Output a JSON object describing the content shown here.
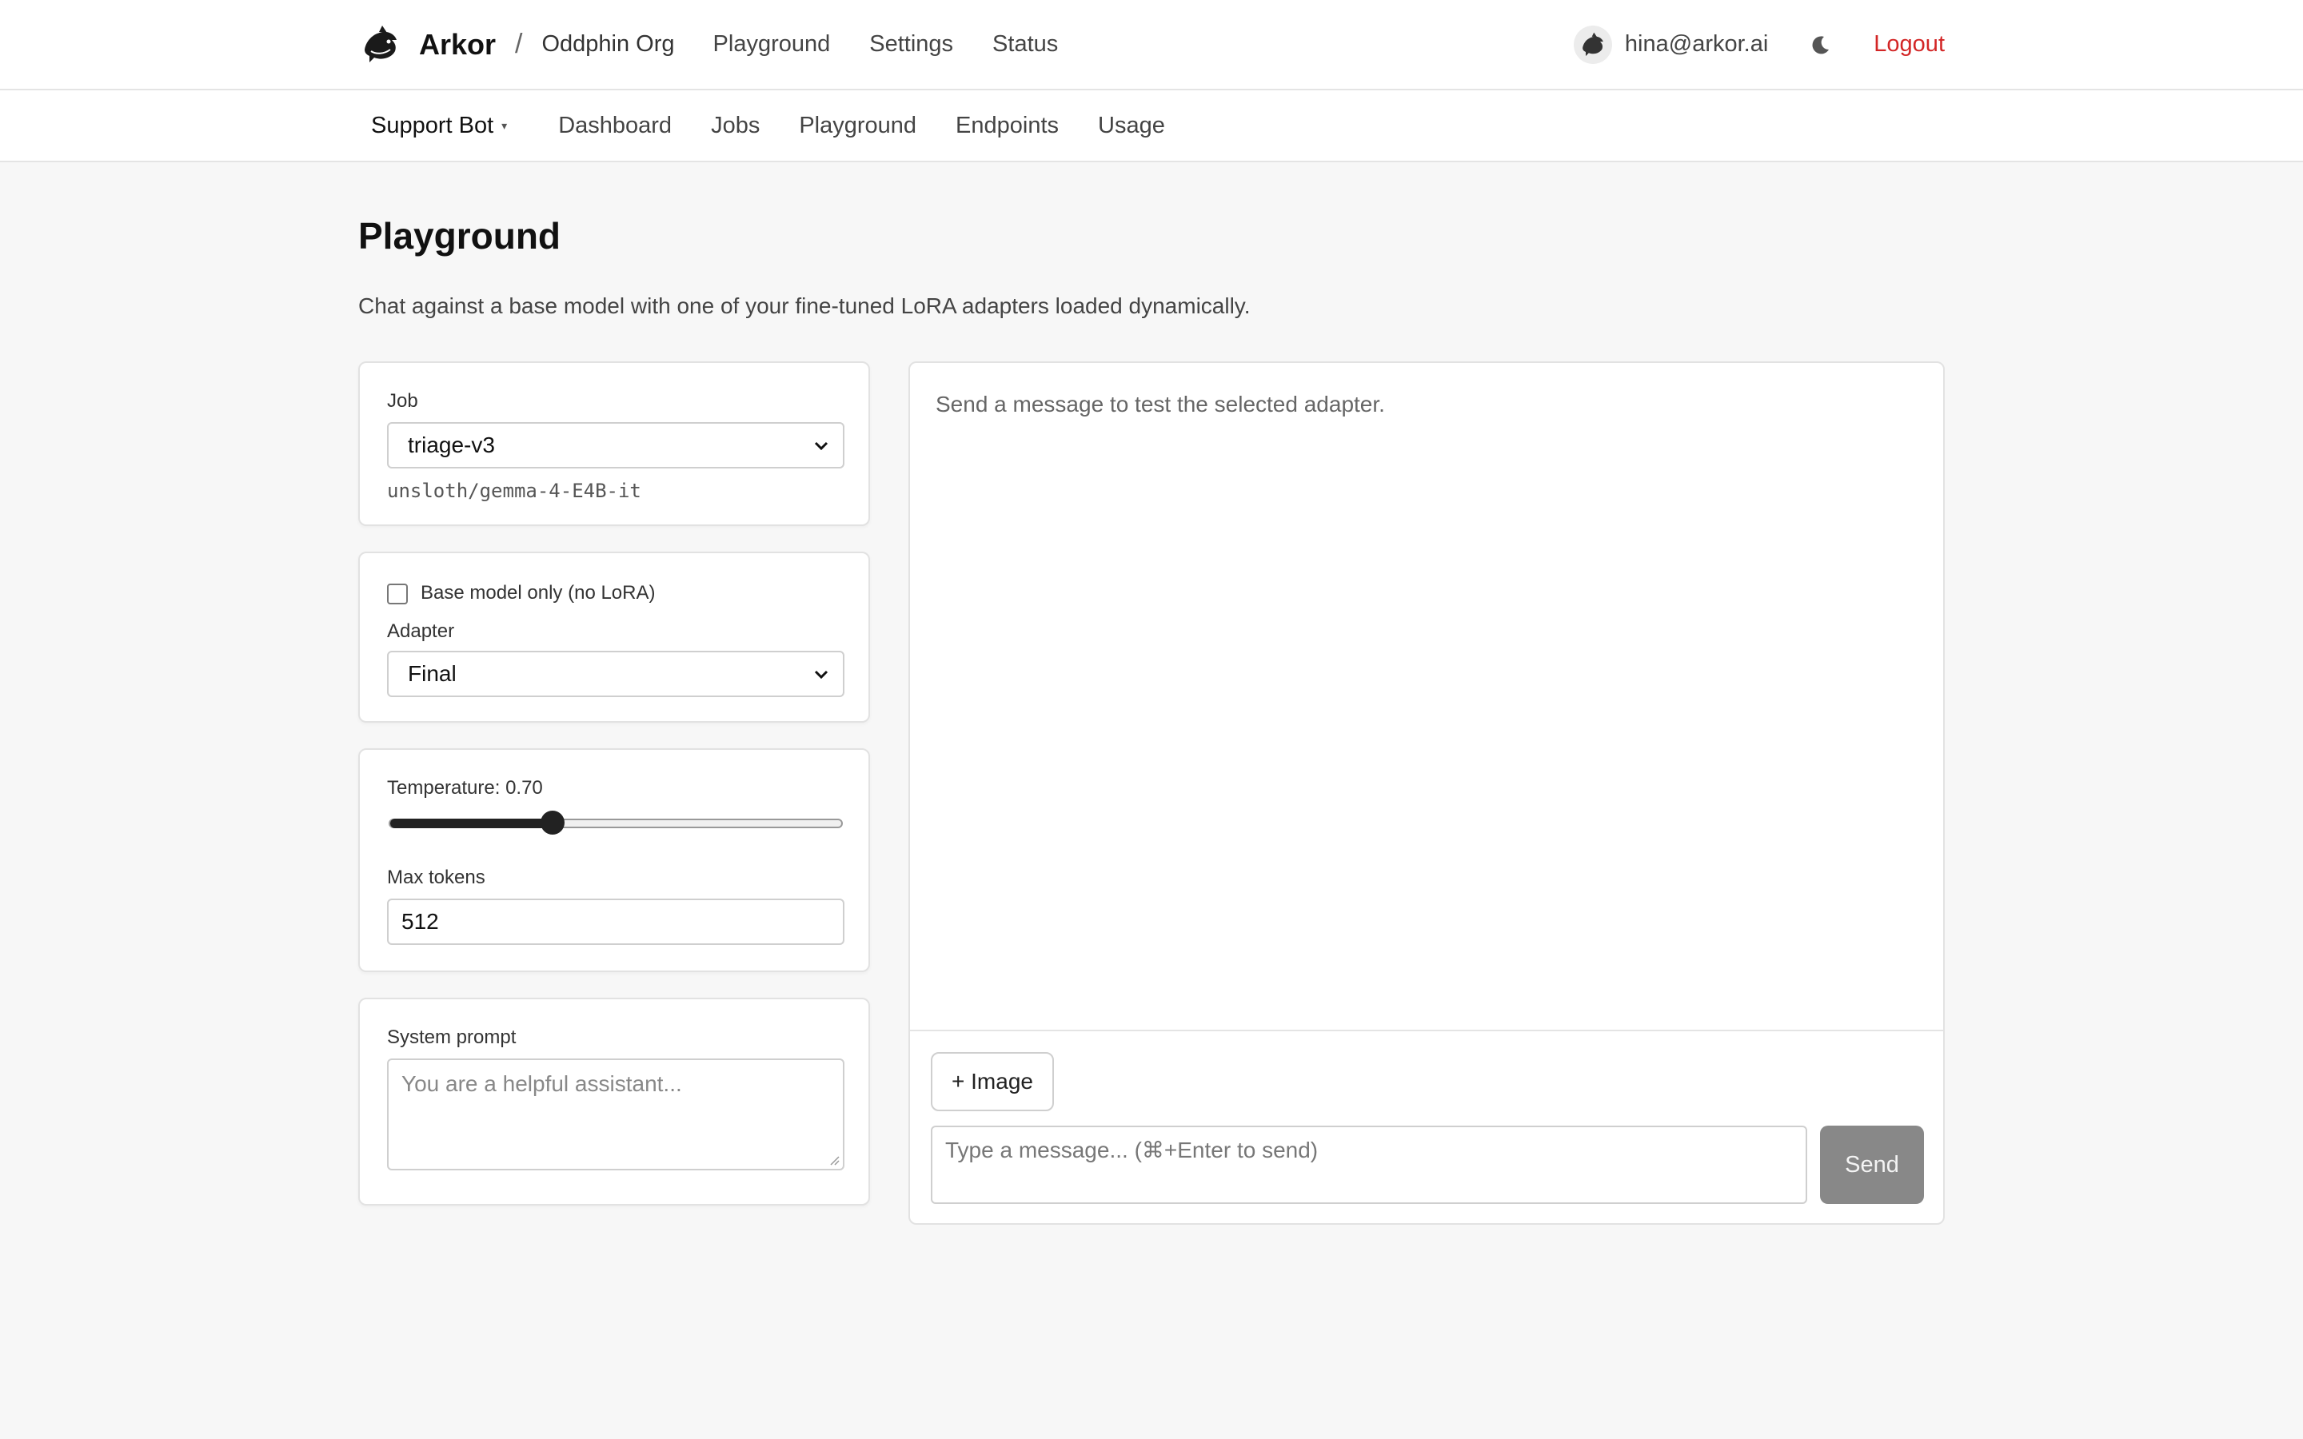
{
  "header": {
    "brand": "Arkor",
    "separator": "/",
    "org": "Oddphin Org",
    "nav": [
      "Playground",
      "Settings",
      "Status"
    ],
    "email": "hina@arkor.ai",
    "logout": "Logout",
    "icons": {
      "logo": "dolphin-logo-icon",
      "theme": "moon-icon"
    }
  },
  "subnav": {
    "project": "Support Bot",
    "caret": "▾",
    "items": [
      "Dashboard",
      "Jobs",
      "Playground",
      "Endpoints",
      "Usage"
    ]
  },
  "page": {
    "title": "Playground",
    "description": "Chat against a base model with one of your fine-tuned LoRA adapters loaded dynamically."
  },
  "job": {
    "label": "Job",
    "selected": "triage-v3",
    "model": "unsloth/gemma-4-E4B-it"
  },
  "adapter": {
    "base_only_label": "Base model only (no LoRA)",
    "base_only_checked": false,
    "label": "Adapter",
    "selected": "Final"
  },
  "params": {
    "temperature_label": "Temperature: 0.70",
    "temperature_fraction": 0.36,
    "max_tokens_label": "Max tokens",
    "max_tokens": "512"
  },
  "system": {
    "label": "System prompt",
    "placeholder": "You are a helpful assistant..."
  },
  "chat": {
    "empty": "Send a message to test the selected adapter.",
    "image_button": "+ Image",
    "input_placeholder": "Type a message... (⌘+Enter to send)",
    "send": "Send"
  },
  "colors": {
    "accent_logout": "#d32626",
    "send_disabled": "#888888"
  }
}
